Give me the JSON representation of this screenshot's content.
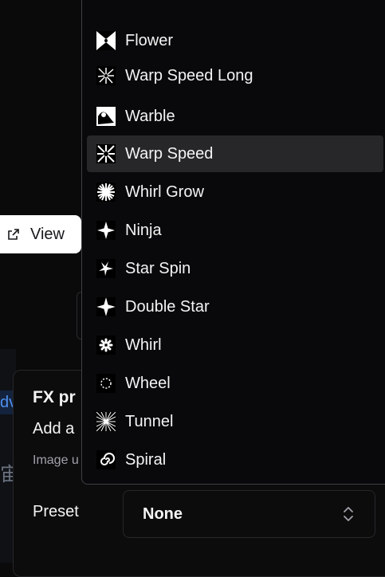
{
  "background": {
    "link_fragment": "dv",
    "glyph_fragment": "宙"
  },
  "view_button": {
    "label": "View",
    "icon": "external-link-icon"
  },
  "fx_panel": {
    "title": "FX pr",
    "description": "Add a",
    "note": "Image u",
    "preset_label": "Preset",
    "preset_value": "None",
    "preset_icon": "chevron-up-down-icon"
  },
  "menu": {
    "items": [
      {
        "label": "Flower",
        "icon": "flower-icon"
      },
      {
        "label": "Warp Speed Long",
        "icon": "warp-speed-long-icon"
      },
      {
        "label": "Warble",
        "icon": "warble-icon"
      },
      {
        "label": "Warp Speed",
        "icon": "warp-speed-icon",
        "highlighted": true
      },
      {
        "label": "Whirl Grow",
        "icon": "whirl-grow-icon"
      },
      {
        "label": "Ninja",
        "icon": "ninja-icon"
      },
      {
        "label": "Star Spin",
        "icon": "star-spin-icon"
      },
      {
        "label": "Double Star",
        "icon": "double-star-icon"
      },
      {
        "label": "Whirl",
        "icon": "whirl-icon"
      },
      {
        "label": "Wheel",
        "icon": "wheel-icon"
      },
      {
        "label": "Tunnel",
        "icon": "tunnel-icon"
      },
      {
        "label": "Spiral",
        "icon": "spiral-icon"
      }
    ]
  },
  "colors": {
    "background": "#0a0a0b",
    "menu_highlight": "#27272a",
    "border": "#27272a",
    "accent_blue": "#3b82f6"
  }
}
